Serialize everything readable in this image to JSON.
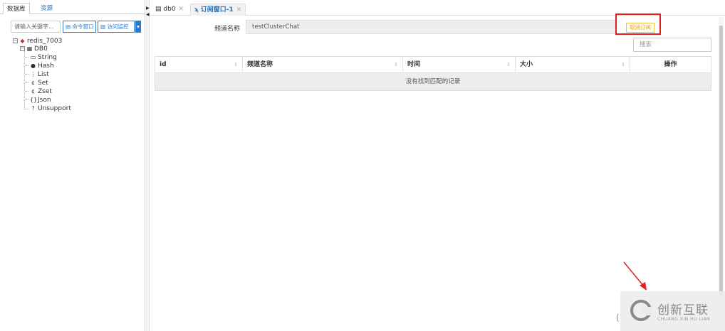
{
  "left_panel": {
    "tabs": [
      {
        "label": "数据库",
        "active": true
      },
      {
        "label": "资源",
        "active": false
      }
    ],
    "search_placeholder": "请输入关键字...",
    "cmd_window_label": "命令窗口",
    "monitor_label": "访问监控",
    "tree": {
      "server": "redis_7003",
      "db": "DB0",
      "types": [
        "String",
        "Hash",
        "List",
        "Set",
        "Zset",
        "Json",
        "Unsupport"
      ]
    }
  },
  "main": {
    "tabs": [
      {
        "label": "db0",
        "active": false
      },
      {
        "label": "订阅窗口-1",
        "active": true
      }
    ],
    "channel_label": "频道名称",
    "channel_value": "testClusterChat",
    "unsubscribe_label": "取消订阅",
    "search_placeholder": "搜索",
    "table": {
      "columns": [
        "id",
        "频道名称",
        "时间",
        "大小",
        "操作"
      ],
      "empty_text": "没有找到匹配的记录"
    }
  },
  "watermark": {
    "cn": "创新互联",
    "en": "CHUANG XIN HU LIAN"
  },
  "colors": {
    "accent": "#1e73be",
    "highlight_box": "#e02020",
    "unsub_text": "#f0a020"
  }
}
